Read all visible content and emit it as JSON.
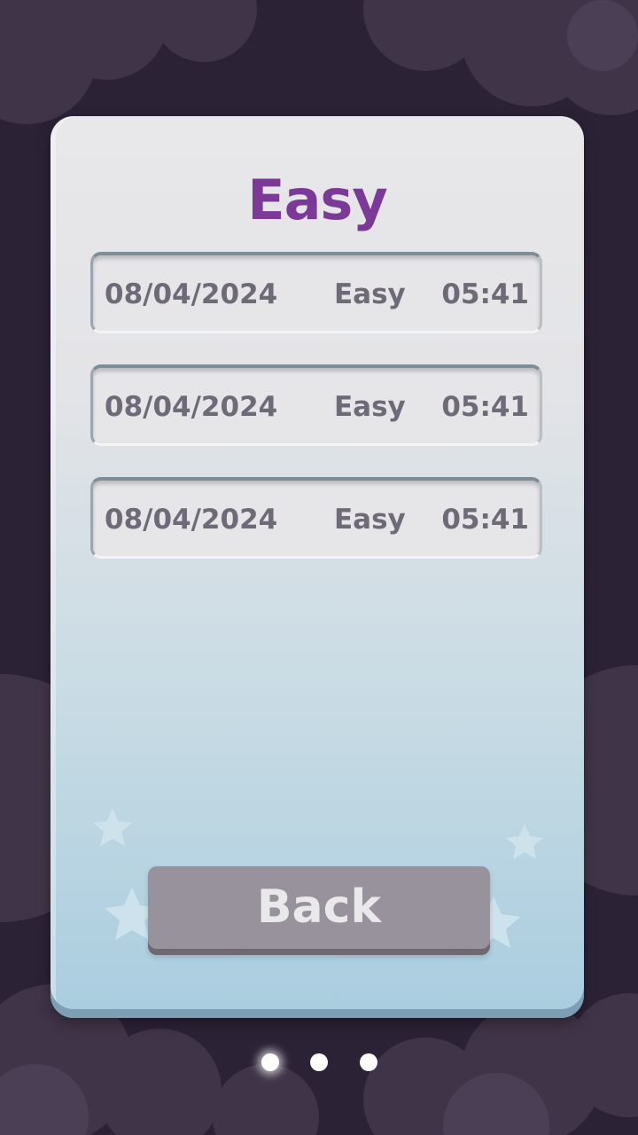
{
  "panel": {
    "title": "Easy"
  },
  "scores": [
    {
      "date": "08/04/2024",
      "difficulty": "Easy",
      "time": "05:41"
    },
    {
      "date": "08/04/2024",
      "difficulty": "Easy",
      "time": "05:41"
    },
    {
      "date": "08/04/2024",
      "difficulty": "Easy",
      "time": "05:41"
    }
  ],
  "back_button": {
    "label": "Back"
  },
  "pager": {
    "page_count": 3,
    "active_page": 1
  },
  "colors": {
    "background": "#2c2236",
    "title": "#7c3a98",
    "row_text": "#6f6a78",
    "button": "#98929d"
  }
}
